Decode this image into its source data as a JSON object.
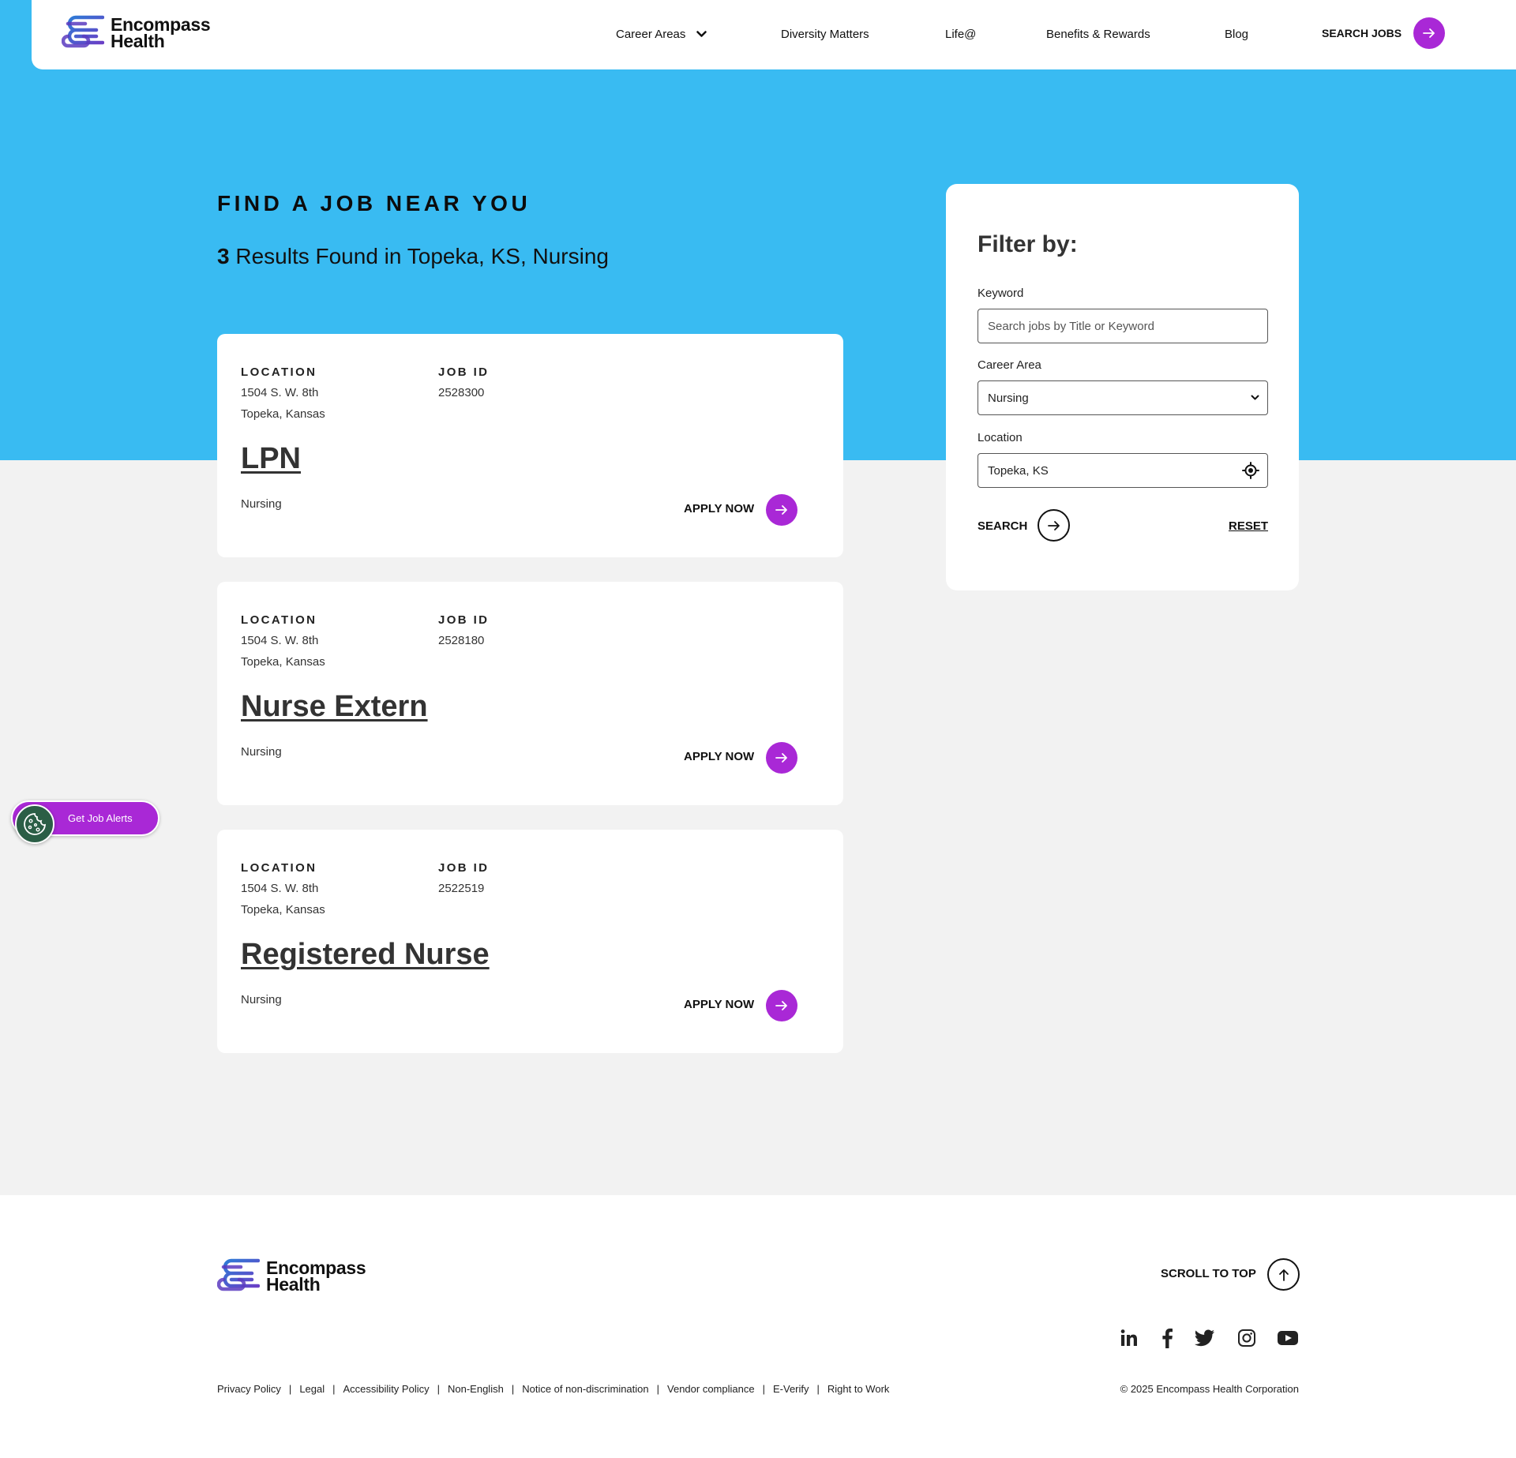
{
  "brand": {
    "name_line1": "Encompass",
    "name_line2": "Health"
  },
  "nav": {
    "career_areas": "Career Areas",
    "diversity": "Diversity Matters",
    "life": "Life@",
    "benefits": "Benefits & Rewards",
    "blog": "Blog",
    "search_jobs": "SEARCH JOBS"
  },
  "hero": {
    "title": "FIND A JOB NEAR YOU",
    "results_count": "3",
    "results_text": "Results Found in Topeka, KS, Nursing"
  },
  "labels": {
    "location": "LOCATION",
    "job_id": "JOB ID",
    "apply_now": "APPLY NOW"
  },
  "jobs": [
    {
      "address": "1504 S. W. 8th",
      "city": "Topeka, Kansas",
      "job_id": "2528300",
      "title": "LPN",
      "category": "Nursing"
    },
    {
      "address": "1504 S. W. 8th",
      "city": "Topeka, Kansas",
      "job_id": "2528180",
      "title": "Nurse Extern",
      "category": "Nursing"
    },
    {
      "address": "1504 S. W. 8th",
      "city": "Topeka, Kansas",
      "job_id": "2522519",
      "title": "Registered Nurse",
      "category": "Nursing"
    }
  ],
  "filter": {
    "title": "Filter by:",
    "keyword_label": "Keyword",
    "keyword_placeholder": "Search jobs by Title or Keyword",
    "career_area_label": "Career Area",
    "career_area_value": "Nursing",
    "location_label": "Location",
    "location_value": "Topeka, KS",
    "search": "SEARCH",
    "reset": "RESET"
  },
  "alerts": {
    "label": "Get Job Alerts"
  },
  "footer": {
    "scroll_top": "SCROLL TO TOP",
    "links": [
      "Privacy Policy",
      "Legal",
      "Accessibility Policy",
      "Non-English",
      "Notice of non-discrimination",
      "Vendor compliance",
      "E-Verify",
      "Right to Work"
    ],
    "copyright": "© 2025 Encompass Health Corporation"
  },
  "colors": {
    "hero_blue": "#39bbf2",
    "accent_purple": "#a928d6",
    "cookie_green": "#2b5e46",
    "page_gray": "#f2f2f2"
  },
  "icons": {
    "logo": "encompass-logo-icon",
    "nav_chevron": "chevron-down-icon",
    "arrow": "arrow-right-icon",
    "select_chevron": "chevron-down-icon",
    "location": "crosshair-icon",
    "cookie": "cookie-icon",
    "scroll": "arrow-up-icon",
    "social": [
      "linkedin-icon",
      "facebook-icon",
      "twitter-icon",
      "instagram-icon",
      "youtube-icon"
    ]
  }
}
